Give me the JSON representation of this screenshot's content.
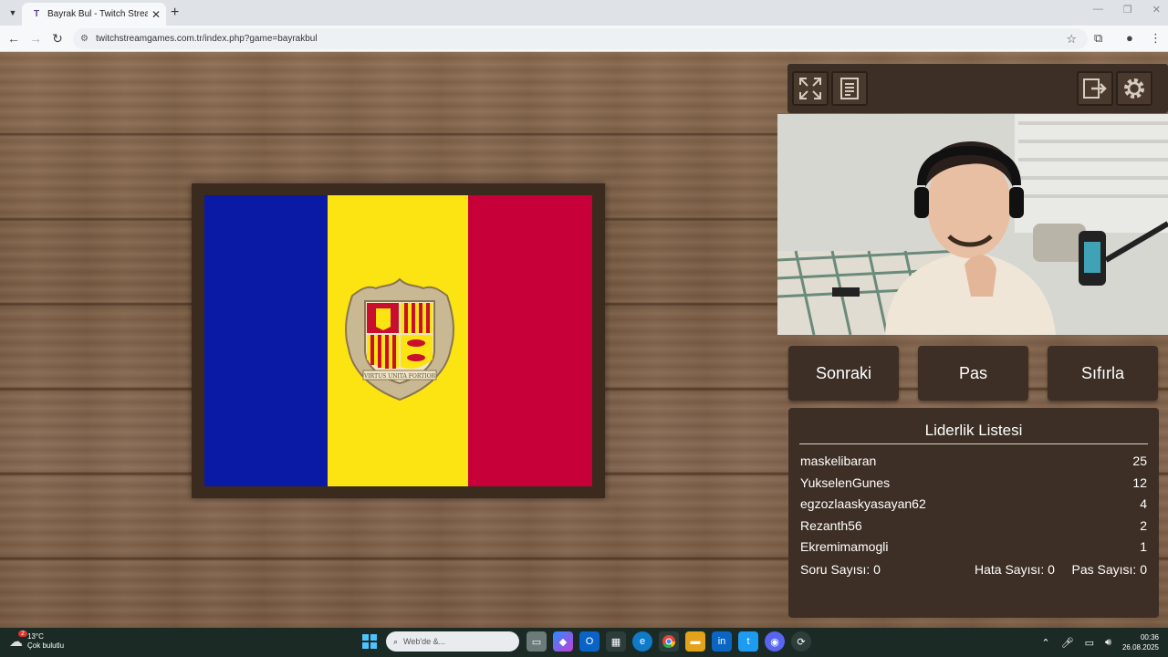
{
  "browser": {
    "tab_title": "Bayrak Bul - Twitch Stream Gar",
    "url": "twitchstreamgames.com.tr/index.php?game=bayrakbul"
  },
  "game": {
    "flag_colors": [
      "#0b1aa5",
      "#fbe412",
      "#c8003a"
    ],
    "motto": "VIRTUS UNITA FORTIOR",
    "buttons": {
      "next": "Sonraki",
      "pass": "Pas",
      "reset": "Sıfırla"
    },
    "leaderboard": {
      "title": "Liderlik Listesi",
      "rows": [
        {
          "name": "maskelibaran",
          "score": "25"
        },
        {
          "name": "YukselenGunes",
          "score": "12"
        },
        {
          "name": "egzozlaaskyasayan62",
          "score": "4"
        },
        {
          "name": "Rezanth56",
          "score": "2"
        },
        {
          "name": "Ekremimamogli",
          "score": "1"
        }
      ],
      "stats": {
        "questions": "Soru Sayısı: 0",
        "errors": "Hata Sayısı: 0",
        "passes": "Pas Sayısı: 0"
      }
    }
  },
  "taskbar": {
    "temperature": "13°C",
    "weather": "Çok bulutlu",
    "weather_badge": "2",
    "search_placeholder": "Web'de &...",
    "time": "00:36",
    "date": "26.08.2025"
  }
}
